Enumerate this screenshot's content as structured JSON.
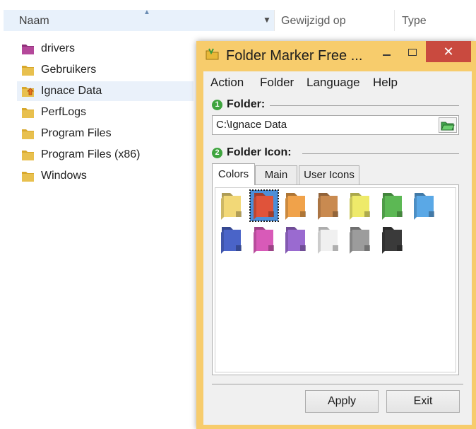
{
  "explorer": {
    "columns": {
      "name": "Naam",
      "modified": "Gewijzigd op",
      "type": "Type"
    },
    "items": [
      {
        "label": "drivers",
        "icon": "folder-purple-icon"
      },
      {
        "label": "Gebruikers",
        "icon": "folder-icon"
      },
      {
        "label": "Ignace Data",
        "icon": "folder-marked-icon",
        "selected": true
      },
      {
        "label": "PerfLogs",
        "icon": "folder-icon"
      },
      {
        "label": "Program Files",
        "icon": "folder-icon"
      },
      {
        "label": "Program Files (x86)",
        "icon": "folder-icon"
      },
      {
        "label": "Windows",
        "icon": "folder-icon"
      }
    ]
  },
  "dialog": {
    "title": "Folder Marker Free ...",
    "close_glyph": "✕",
    "menu": [
      "Action",
      "Folder",
      "Language",
      "Help"
    ],
    "folder_section": {
      "number": "1",
      "label": "Folder:",
      "path": "C:\\Ignace Data"
    },
    "icon_section": {
      "number": "2",
      "label": "Folder Icon:"
    },
    "tabs": [
      {
        "label": "Colors",
        "active": true
      },
      {
        "label": "Main",
        "active": false
      },
      {
        "label": "User Icons",
        "active": false
      }
    ],
    "colors": [
      "#f2d877",
      "#e0533a",
      "#f0a24a",
      "#c98a50",
      "#eeea6a",
      "#5cb854",
      "#5aa8e6",
      "#4a64c8",
      "#d85ab8",
      "#9a6ad0",
      "#f0f0f0",
      "#9c9c9c",
      "#3a3a3a"
    ],
    "selected_color_index": 1,
    "buttons": {
      "apply": "Apply",
      "exit": "Exit"
    }
  },
  "accent_colors": {
    "dialog_frame": "#f7cc6c",
    "close": "#c94a3f",
    "step_badge": "#3ea43e"
  }
}
